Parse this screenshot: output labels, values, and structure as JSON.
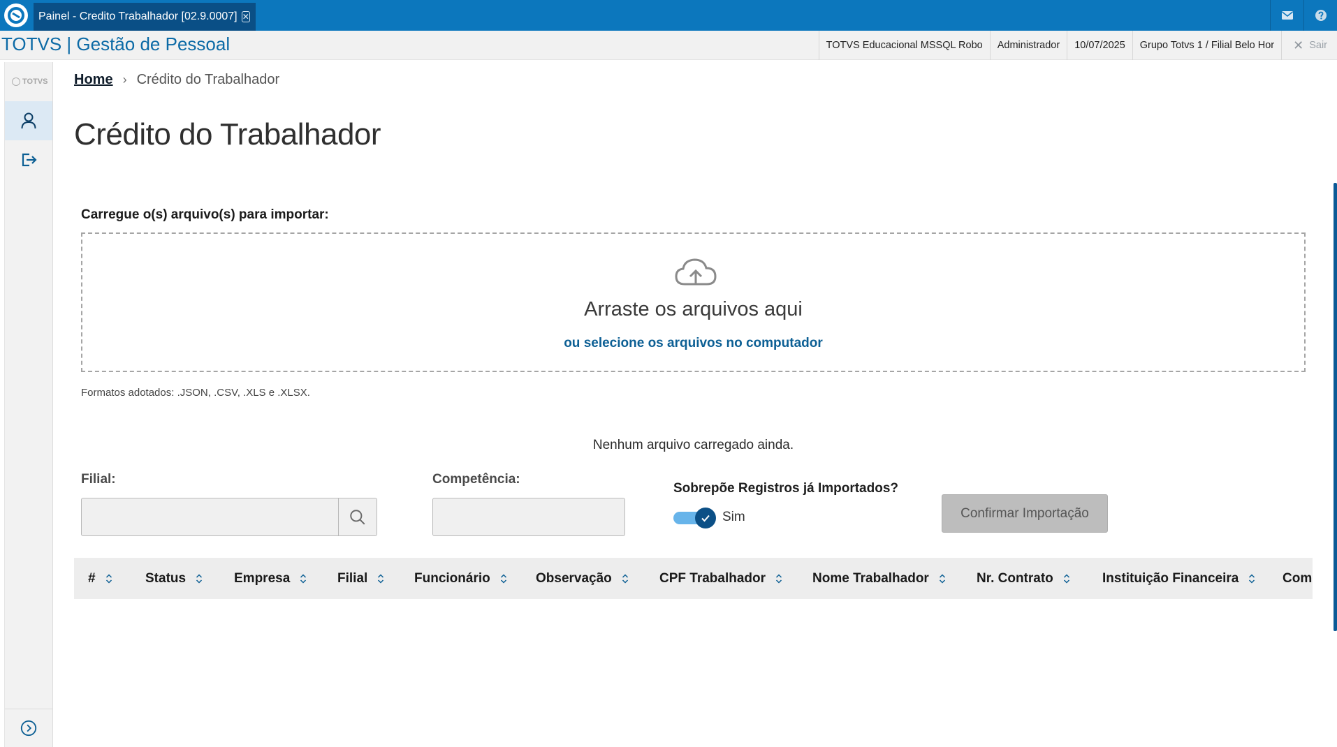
{
  "window": {
    "tab_title": "Painel - Credito Trabalhador [02.9.0007]",
    "tab_close_glyph": "✕"
  },
  "header": {
    "product_title": "TOTVS | Gestão de Pessoal",
    "session": {
      "database": "TOTVS Educacional MSSQL Robo",
      "user": "Administrador",
      "date": "10/07/2025",
      "branch": "Grupo Totvs 1 / Filial Belo Hor",
      "logout_label": "Sair"
    }
  },
  "rail": {
    "logo_text": "TOTVS"
  },
  "breadcrumb": {
    "home": "Home",
    "separator": "›",
    "current": "Crédito do Trabalhador"
  },
  "page": {
    "title": "Crédito do Trabalhador"
  },
  "upload": {
    "label": "Carregue o(s) arquivo(s) para importar:",
    "drop_title": "Arraste os arquivos aqui",
    "select_link": "ou selecione os arquivos no computador",
    "formats_note": "Formatos adotados: .JSON, .CSV, .XLS e .XLSX.",
    "empty_message": "Nenhum arquivo carregado ainda."
  },
  "form": {
    "filial_label": "Filial:",
    "filial_value": "",
    "competencia_label": "Competência:",
    "competencia_value": "",
    "overwrite_label": "Sobrepõe Registros já Importados?",
    "overwrite_checked": true,
    "overwrite_text": "Sim",
    "confirm_label": "Confirmar Importação"
  },
  "table": {
    "columns": [
      "#",
      "Status",
      "Empresa",
      "Filial",
      "Funcionário",
      "Observação",
      "CPF Trabalhador",
      "Nome Trabalhador",
      "Nr. Contrato",
      "Instituição Financeira",
      "Comp"
    ]
  },
  "colors": {
    "topbar": "#0c77bd",
    "active_tab": "#0a4f86",
    "brand_text": "#0c6aa6",
    "link": "#0c5f94",
    "switch_track": "#67b4ea",
    "switch_knob": "#0b4f86",
    "disabled_button": "#bdbdbd"
  },
  "icons": {
    "app_logo": "totvs-logo-icon",
    "mail": "mail-icon",
    "help": "help-icon",
    "rail_user": "user-icon",
    "rail_exit": "logout-icon",
    "rail_expand": "chevron-right-circle-icon",
    "upload": "cloud-upload-icon",
    "lookup": "search-icon"
  }
}
